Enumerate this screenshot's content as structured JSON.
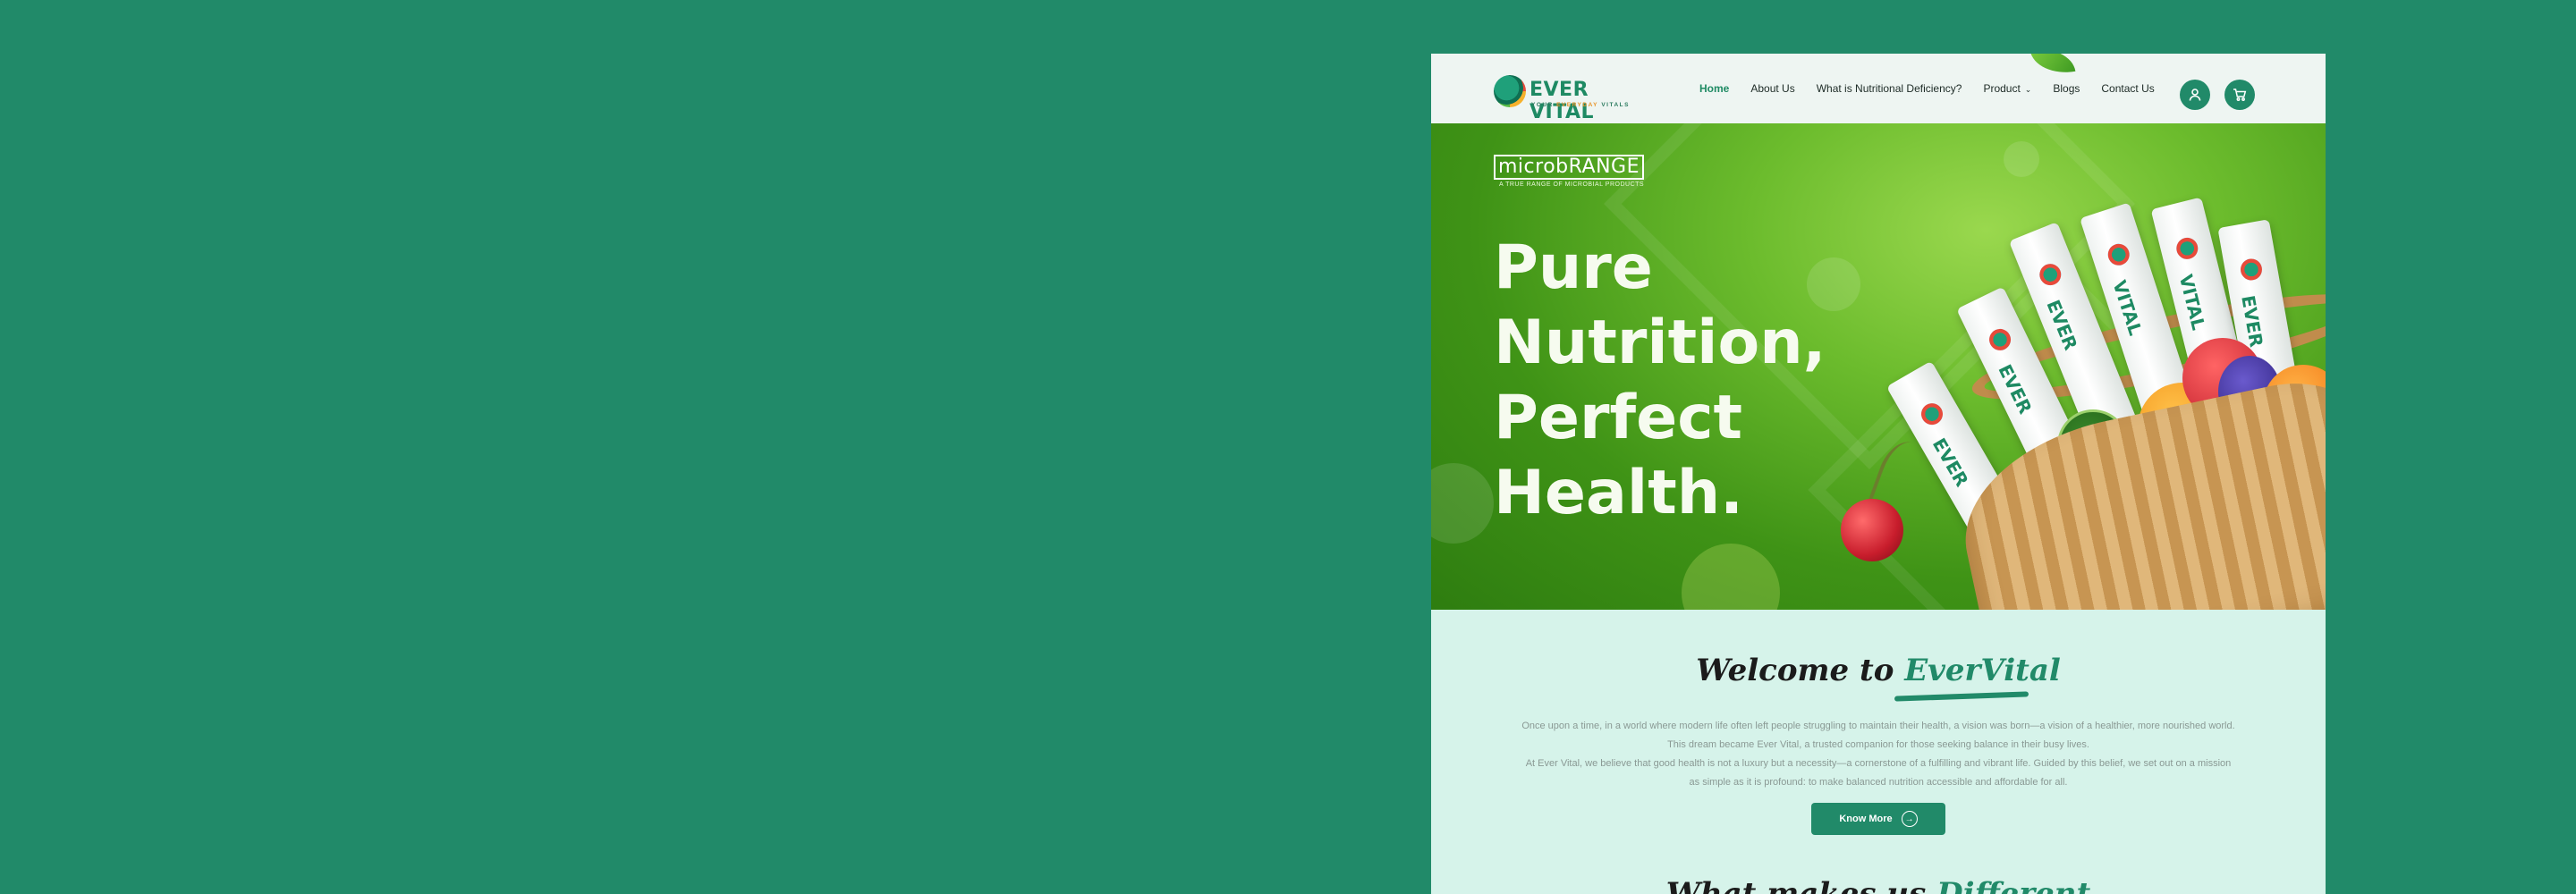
{
  "brand": {
    "name": "EVER VITAL",
    "tagline_a": "YOUR",
    "tagline_b": "EVERYDAY",
    "tagline_c": "VITALS"
  },
  "nav": {
    "items": [
      {
        "label": "Home",
        "active": true
      },
      {
        "label": "About Us"
      },
      {
        "label": "What is Nutritional Deficiency?"
      },
      {
        "label": "Product"
      },
      {
        "label": "Blogs"
      },
      {
        "label": "Contact Us"
      }
    ]
  },
  "header_icons": [
    "user-icon",
    "cart-icon"
  ],
  "hero": {
    "badge_a": "microb",
    "badge_b": "RANGE",
    "badge_sub": "A TRUE RANGE OF MICROBIAL PRODUCTS",
    "headline_lines": [
      "Pure",
      "Nutrition,",
      "Perfect",
      "Health."
    ],
    "sachet_text_1": "EVER",
    "sachet_text_2": "VITAL"
  },
  "welcome": {
    "title_prefix": "Welcome to",
    "title_accent": "EverVital",
    "para_1": "Once upon a time, in a world where modern life often left people struggling to maintain their health, a vision was born—a vision of a healthier, more nourished world. This dream became Ever Vital, a trusted companion for those seeking balance in their busy lives.",
    "para_2": "At Ever Vital, we believe that good health is not a luxury but a necessity—a cornerstone of a fulfilling and vibrant life. Guided by this belief, we set out on a mission as simple as it is profound: to make balanced nutrition accessible and affordable for all.",
    "button_label": "Know More"
  },
  "next_section": {
    "title_prefix": "What makes us",
    "title_accent": "Different"
  },
  "colors": {
    "brand_green": "#218a69",
    "hero_green": "#6cbc2d",
    "section_bg": "#d6f3ea"
  }
}
